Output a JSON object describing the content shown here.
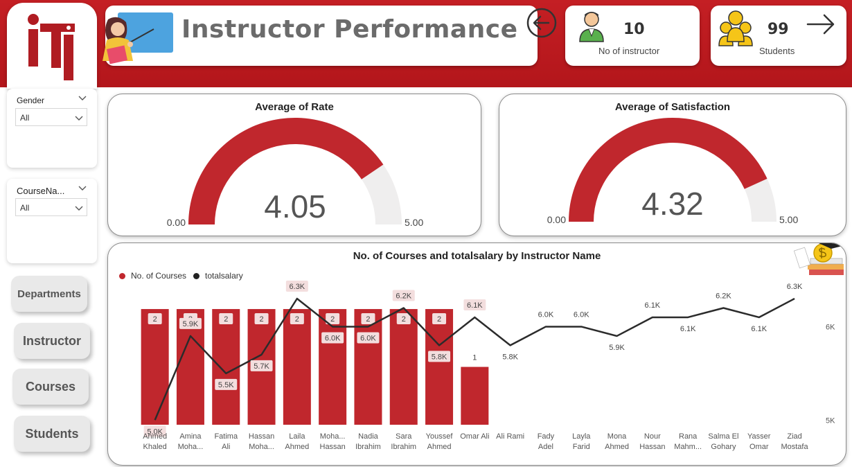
{
  "header": {
    "title": "Instructor Performance"
  },
  "kpis": [
    {
      "value": "10",
      "label": "No of instructor",
      "icon": "instructor-icon"
    },
    {
      "value": "99",
      "label": "Students",
      "icon": "students-group-icon"
    }
  ],
  "filters": [
    {
      "label": "Gender",
      "selected": "All"
    },
    {
      "label": "CourseNa...",
      "selected": "All"
    }
  ],
  "nav": {
    "departments": "Departments",
    "instructor": "Instructor",
    "courses": "Courses",
    "students": "Students"
  },
  "colors": {
    "brand_red": "#c0272d",
    "gauge_track": "#efeeee",
    "line": "#2b2b2b"
  },
  "gauges": [
    {
      "title": "Average of Rate",
      "value": 4.05,
      "display": "4.05",
      "min": 0,
      "max": 5,
      "min_label": "0.00",
      "max_label": "5.00"
    },
    {
      "title": "Average of Satisfaction",
      "value": 4.32,
      "display": "4.32",
      "min": 0,
      "max": 5,
      "min_label": "0.00",
      "max_label": "5.00"
    }
  ],
  "chart_data": {
    "type": "bar",
    "title": "No. of Courses and totalsalary by Instructor Name",
    "categories": [
      [
        "Ahmed",
        "Khaled"
      ],
      [
        "Amina",
        "Moha..."
      ],
      [
        "Fatima",
        "Ali"
      ],
      [
        "Hassan",
        "Moha..."
      ],
      [
        "Laila",
        "Ahmed"
      ],
      [
        "Moha...",
        "Hassan"
      ],
      [
        "Nadia",
        "Ibrahim"
      ],
      [
        "Sara",
        "Ibrahim"
      ],
      [
        "Youssef",
        "Ahmed"
      ],
      [
        "Omar Ali"
      ],
      [
        "Ali Rami"
      ],
      [
        "Fady",
        "Adel"
      ],
      [
        "Layla",
        "Farid"
      ],
      [
        "Mona",
        "Ahmed"
      ],
      [
        "Nour",
        "Hassan"
      ],
      [
        "Rana",
        "Mahm..."
      ],
      [
        "Salma El",
        "Gohary"
      ],
      [
        "Yasser",
        "Omar"
      ],
      [
        "Ziad",
        "Mostafa"
      ]
    ],
    "series": [
      {
        "name": "No. of Courses",
        "kind": "bar",
        "values": [
          2,
          2,
          2,
          2,
          2,
          2,
          2,
          2,
          2,
          1,
          0,
          0,
          0,
          0,
          0,
          0,
          0,
          0,
          0
        ],
        "labels": [
          "2",
          "2",
          "2",
          "2",
          "2",
          "2",
          "2",
          "2",
          "2",
          "1",
          "",
          "",
          "",
          "",
          "",
          "",
          "",
          "",
          ""
        ]
      },
      {
        "name": "totalsalary",
        "kind": "line",
        "values": [
          5000,
          5900,
          5500,
          5700,
          6300,
          6000,
          6000,
          6200,
          5800,
          6100,
          5800,
          6000,
          6000,
          5900,
          6100,
          6100,
          6200,
          6100,
          6300
        ],
        "labels": [
          "5.0K",
          "5.9K",
          "5.5K",
          "5.7K",
          "6.3K",
          "6.0K",
          "6.0K",
          "6.2K",
          "5.8K",
          "6.1K",
          "5.8K",
          "6.0K",
          "6.0K",
          "5.9K",
          "6.1K",
          "6.1K",
          "6.2K",
          "6.1K",
          "6.3K"
        ]
      }
    ],
    "y_left_range": [
      0,
      2.3
    ],
    "y_right_range": [
      4950,
      6300
    ],
    "y_right_ticks": [
      "6K",
      "5K"
    ],
    "y_right_tick_values": [
      6000,
      5000
    ],
    "legend": "top-left"
  }
}
